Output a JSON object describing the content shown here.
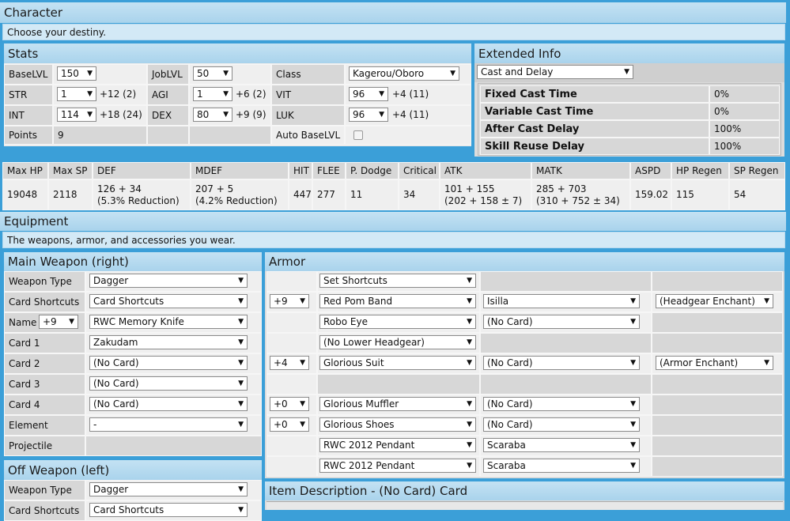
{
  "character": {
    "title": "Character",
    "subtitle": "Choose your destiny."
  },
  "stats": {
    "title": "Stats",
    "base_lvl_label": "BaseLVL",
    "base_lvl": "150",
    "job_lvl_label": "JobLVL",
    "job_lvl": "50",
    "class_label": "Class",
    "class": "Kagerou/Oboro",
    "str_label": "STR",
    "str": "1",
    "str_bonus": "+12 (2)",
    "agi_label": "AGI",
    "agi": "1",
    "agi_bonus": "+6 (2)",
    "vit_label": "VIT",
    "vit": "96",
    "vit_bonus": "+4 (11)",
    "int_label": "INT",
    "int": "114",
    "int_bonus": "+18 (24)",
    "dex_label": "DEX",
    "dex": "80",
    "dex_bonus": "+9 (9)",
    "luk_label": "LUK",
    "luk": "96",
    "luk_bonus": "+4 (11)",
    "points_label": "Points",
    "points": "9",
    "auto_label": "Auto BaseLVL"
  },
  "extended": {
    "title": "Extended Info",
    "mode": "Cast and Delay",
    "rows": [
      {
        "label": "Fixed Cast Time",
        "value": "0%"
      },
      {
        "label": "Variable Cast Time",
        "value": "0%"
      },
      {
        "label": "After Cast Delay",
        "value": "100%"
      },
      {
        "label": "Skill Reuse Delay",
        "value": "100%"
      }
    ]
  },
  "summary": {
    "headers": [
      "Max HP",
      "Max SP",
      "DEF",
      "MDEF",
      "HIT",
      "FLEE",
      "P. Dodge",
      "Critical",
      "ATK",
      "MATK",
      "ASPD",
      "HP Regen",
      "SP Regen"
    ],
    "values": [
      "19048",
      "2118",
      "126 + 34",
      "207 + 5",
      "447",
      "277",
      "11",
      "34",
      "101 + 155",
      "285 + 703",
      "159.02",
      "115",
      "54"
    ],
    "values2": [
      "",
      "",
      "(5.3% Reduction)",
      "(4.2% Reduction)",
      "",
      "",
      "",
      "",
      "(202 + 158 ± 7)",
      "(310 + 752 ± 34)",
      "",
      "",
      ""
    ]
  },
  "equipment": {
    "title": "Equipment",
    "subtitle": "The weapons, armor, and accessories you wear."
  },
  "main_weapon": {
    "title": "Main Weapon (right)",
    "weapon_type_label": "Weapon Type",
    "weapon_type": "Dagger",
    "card_shortcuts_label": "Card Shortcuts",
    "card_shortcuts": "Card Shortcuts",
    "name_label": "Name",
    "refine": "+9",
    "name": "RWC Memory Knife",
    "card1_label": "Card 1",
    "card1": "Zakudam",
    "card2_label": "Card 2",
    "card2": "(No Card)",
    "card3_label": "Card 3",
    "card3": "(No Card)",
    "card4_label": "Card 4",
    "card4": "(No Card)",
    "element_label": "Element",
    "element": "-",
    "projectile_label": "Projectile"
  },
  "off_weapon": {
    "title": "Off Weapon (left)",
    "weapon_type_label": "Weapon Type",
    "weapon_type": "Dagger",
    "card_shortcuts_label": "Card Shortcuts",
    "card_shortcuts": "Card Shortcuts"
  },
  "armor": {
    "title": "Armor",
    "rows": [
      {
        "refine": "",
        "item": "Set Shortcuts",
        "card": "",
        "enchant": ""
      },
      {
        "refine": "+9",
        "item": "Red Pom Band",
        "card": "Isilla",
        "enchant": "(Headgear Enchant)"
      },
      {
        "refine": "",
        "item": "Robo Eye",
        "card": "(No Card)",
        "enchant": ""
      },
      {
        "refine": "",
        "item": "(No Lower Headgear)",
        "card": "",
        "enchant": ""
      },
      {
        "refine": "+4",
        "item": "Glorious Suit",
        "card": "(No Card)",
        "enchant": "(Armor Enchant)"
      },
      {
        "refine": "",
        "item": "",
        "card": "",
        "enchant": ""
      },
      {
        "refine": "+0",
        "item": "Glorious Muffler",
        "card": "(No Card)",
        "enchant": ""
      },
      {
        "refine": "+0",
        "item": "Glorious Shoes",
        "card": "(No Card)",
        "enchant": ""
      },
      {
        "refine": "",
        "item": "RWC 2012 Pendant",
        "card": "Scaraba",
        "enchant": ""
      },
      {
        "refine": "",
        "item": "RWC 2012 Pendant",
        "card": "Scaraba",
        "enchant": ""
      }
    ]
  },
  "item_desc": {
    "title": "Item Description - (No Card) Card"
  },
  "icons": {
    "dropdown": "triangle-down-icon"
  }
}
